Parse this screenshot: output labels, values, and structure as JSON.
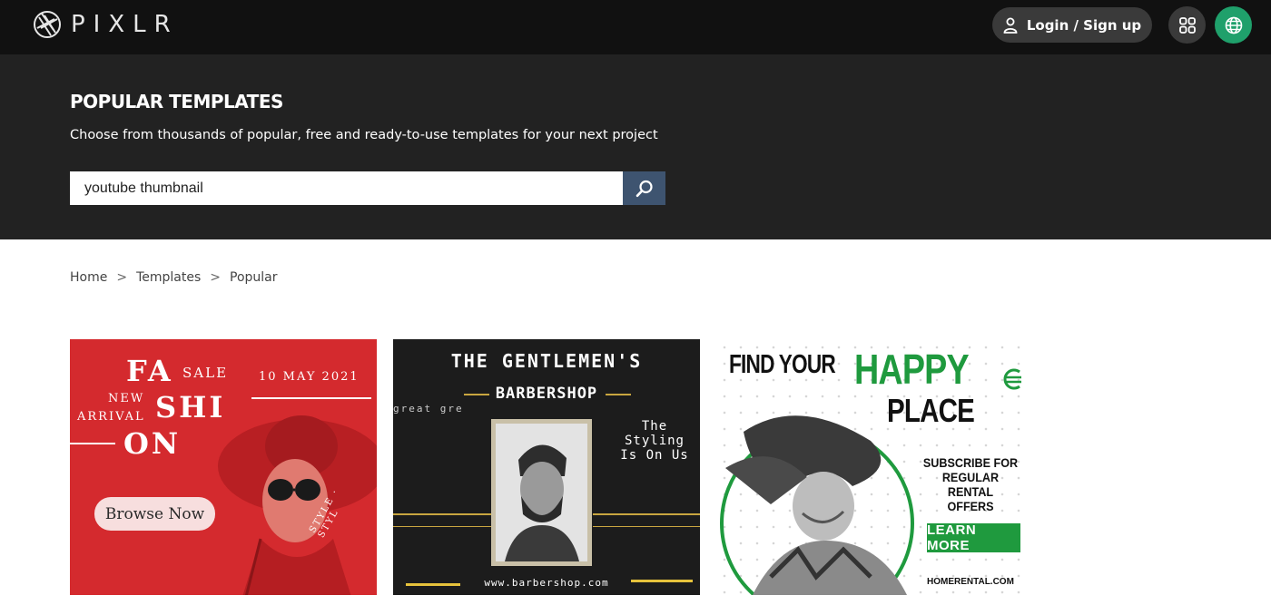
{
  "header": {
    "logo_text": "PIXLR",
    "login_label": "Login / Sign up",
    "icons": {
      "logo": "pixlr-aperture-icon",
      "user": "user-icon",
      "apps": "apps-grid-icon",
      "language": "globe-icon"
    },
    "colors": {
      "background": "#111111",
      "button": "#3a3a3a",
      "language_button": "#1fa06b"
    }
  },
  "hero": {
    "title": "POPULAR TEMPLATES",
    "subtitle": "Choose from thousands of popular, free and ready-to-use templates for your next project",
    "search_value": "youtube thumbnail",
    "search_icon": "search-icon",
    "colors": {
      "background": "#222222",
      "search_button": "#3e5470"
    }
  },
  "breadcrumb": {
    "items": [
      "Home",
      "Templates",
      "Popular"
    ],
    "separator": ">"
  },
  "templates": [
    {
      "name": "fashion-sale",
      "texts": {
        "fa": "FA",
        "sale": "SALE",
        "date": "10 MAY 2021",
        "new": "NEW",
        "arrival": "ARRIVAL",
        "shi": "SHI",
        "on": "ON",
        "button": "Browse Now",
        "style": "STYLE · STYL"
      },
      "colors": {
        "background": "#d42a2e"
      }
    },
    {
      "name": "barbershop",
      "texts": {
        "title": "THE GENTLEMEN'S",
        "subtitle": "BARBERSHOP",
        "styling": "The Styling Is On Us",
        "great": "great gre",
        "url": "www.barbershop.com"
      },
      "colors": {
        "background": "#1c1c1c",
        "accent": "#c9a640"
      }
    },
    {
      "name": "happy-place-rental",
      "texts": {
        "find": "FIND YOUR",
        "happy": "HAPPY",
        "place": "PLACE",
        "subscribe": "SUBSCRIBE FOR REGULAR RENTAL OFFERS",
        "button": "LEARN MORE",
        "url": "HOMERENTAL.COM"
      },
      "colors": {
        "accent": "#1f9a3e"
      }
    }
  ]
}
